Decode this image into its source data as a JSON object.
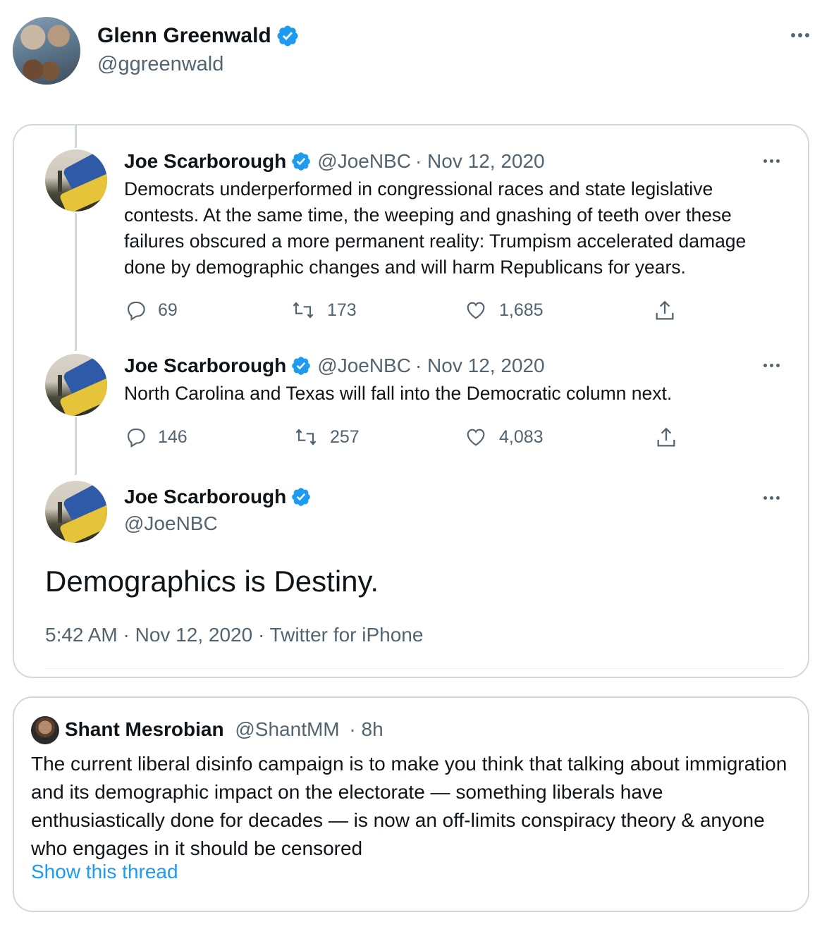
{
  "author": {
    "name": "Glenn Greenwald",
    "handle": "@ggreenwald"
  },
  "quoted_thread": {
    "tweets": [
      {
        "name": "Joe Scarborough",
        "handle": "@JoeNBC",
        "date": "· Nov 12, 2020",
        "text": "Democrats underperformed in congressional races and state legislative contests. At the same time, the weeping and gnashing of teeth over these failures obscured a more permanent reality: Trumpism accelerated damage done by demographic changes and will harm Republicans for years.",
        "replies": "69",
        "retweets": "173",
        "likes": "1,685"
      },
      {
        "name": "Joe Scarborough",
        "handle": "@JoeNBC",
        "date": "· Nov 12, 2020",
        "text": "North Carolina and Texas will fall into the Democratic column next.",
        "replies": "146",
        "retweets": "257",
        "likes": "4,083"
      }
    ],
    "main": {
      "name": "Joe Scarborough",
      "handle": "@JoeNBC",
      "text": "Demographics is Destiny.",
      "meta": "5:42 AM · Nov 12, 2020 · Twitter for iPhone"
    }
  },
  "quote": {
    "name": "Shant Mesrobian",
    "handle": "@ShantMM",
    "time": "· 8h",
    "text": "The current liberal disinfo campaign is to make you think that talking about immigration and its demographic impact on the electorate — something liberals have enthusiastically done for decades — is now an off-limits conspiracy theory & anyone who engages in it should be censored",
    "link": "Show this thread"
  },
  "colors": {
    "verified": "#1d9bf0",
    "secondary_text": "#536471",
    "link": "#1d9bf0",
    "border": "#cfd9de"
  },
  "icons": [
    "verified-badge-icon",
    "more-icon",
    "reply-icon",
    "retweet-icon",
    "like-icon",
    "share-icon"
  ]
}
